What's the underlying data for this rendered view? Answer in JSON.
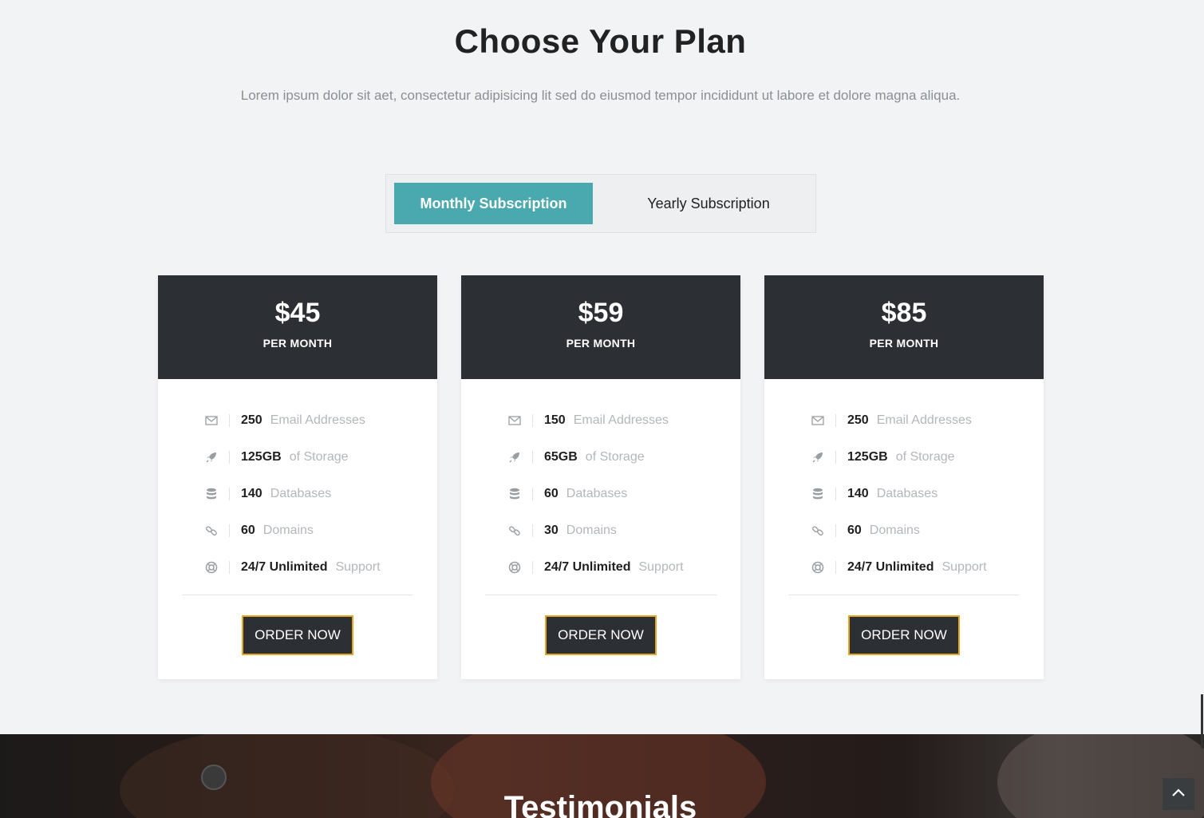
{
  "header": {
    "title": "Choose Your Plan",
    "subtitle": "Lorem ipsum dolor sit aet, consectetur adipisicing lit sed do eiusmod tempor incididunt ut labore et dolore magna aliqua."
  },
  "toggle": {
    "monthly_label": "Monthly Subscription",
    "yearly_label": "Yearly Subscription",
    "active": "monthly"
  },
  "plans": [
    {
      "price": "$45",
      "period": "PER MONTH",
      "features": [
        {
          "icon": "envelope-icon",
          "value": "250",
          "label": "Email Addresses"
        },
        {
          "icon": "rocket-icon",
          "value": "125GB",
          "label": "of Storage"
        },
        {
          "icon": "database-icon",
          "value": "140",
          "label": "Databases"
        },
        {
          "icon": "link-icon",
          "value": "60",
          "label": "Domains"
        },
        {
          "icon": "life-ring-icon",
          "value": "24/7 Unlimited",
          "label": "Support"
        }
      ],
      "cta": "ORDER NOW"
    },
    {
      "price": "$59",
      "period": "PER MONTH",
      "features": [
        {
          "icon": "envelope-icon",
          "value": "150",
          "label": "Email Addresses"
        },
        {
          "icon": "rocket-icon",
          "value": "65GB",
          "label": "of Storage"
        },
        {
          "icon": "database-icon",
          "value": "60",
          "label": "Databases"
        },
        {
          "icon": "link-icon",
          "value": "30",
          "label": "Domains"
        },
        {
          "icon": "life-ring-icon",
          "value": "24/7 Unlimited",
          "label": "Support"
        }
      ],
      "cta": "ORDER NOW"
    },
    {
      "price": "$85",
      "period": "PER MONTH",
      "features": [
        {
          "icon": "envelope-icon",
          "value": "250",
          "label": "Email Addresses"
        },
        {
          "icon": "rocket-icon",
          "value": "125GB",
          "label": "of Storage"
        },
        {
          "icon": "database-icon",
          "value": "140",
          "label": "Databases"
        },
        {
          "icon": "link-icon",
          "value": "60",
          "label": "Domains"
        },
        {
          "icon": "life-ring-icon",
          "value": "24/7 Unlimited",
          "label": "Support"
        }
      ],
      "cta": "ORDER NOW"
    }
  ],
  "testimonials": {
    "title": "Testimonials"
  },
  "colors": {
    "accent": "#4aa9ae",
    "card_header": "#2c2f33",
    "button_border": "#e8a520",
    "page_bg": "#f2f3f5"
  }
}
